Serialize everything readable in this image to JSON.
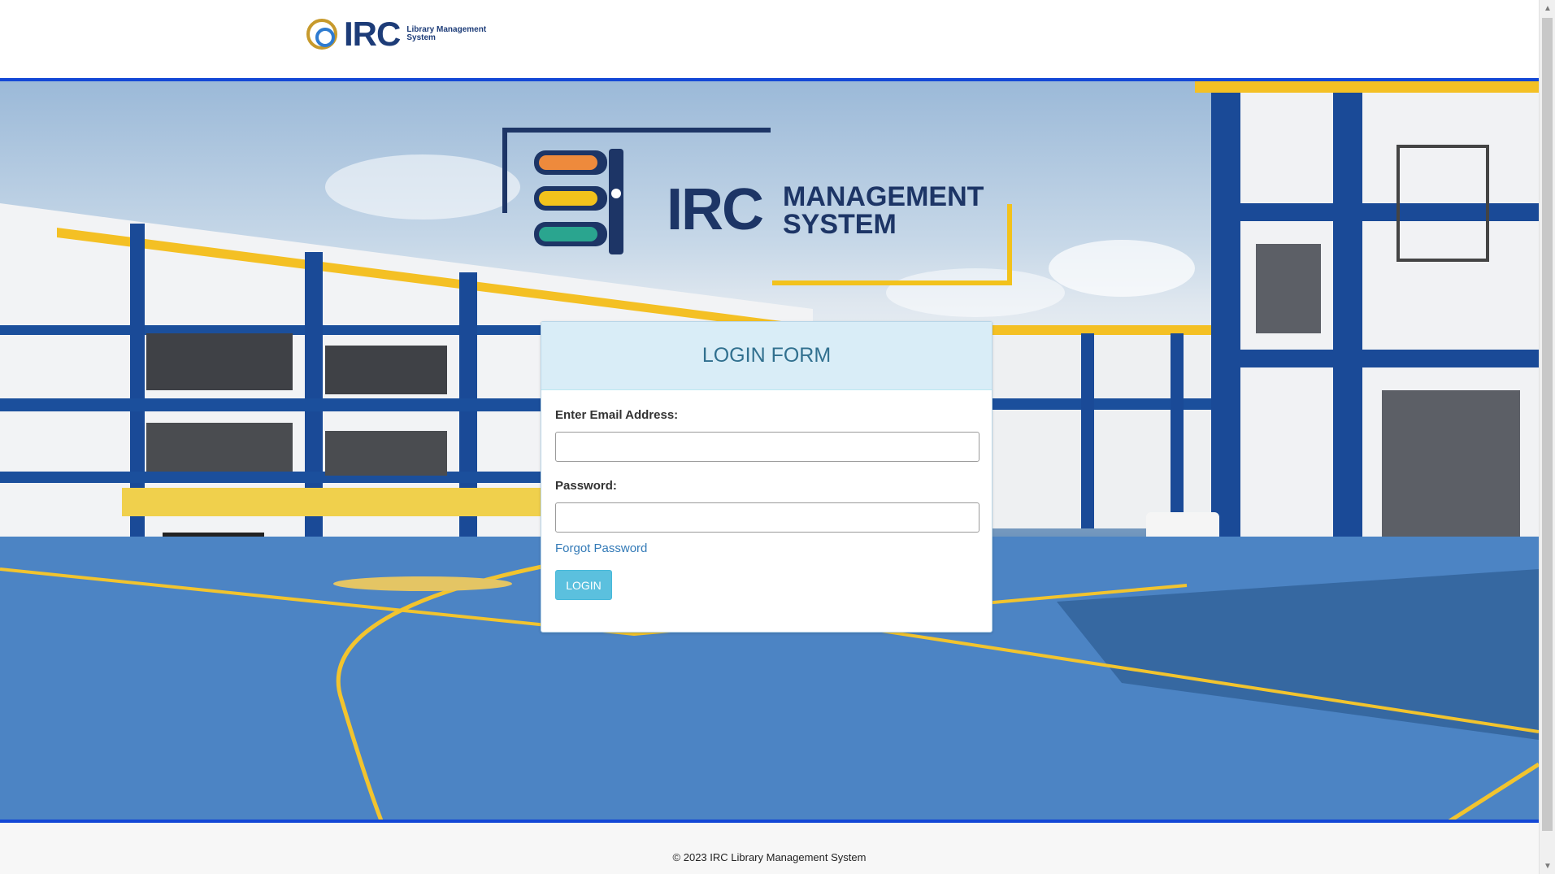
{
  "header": {
    "logo_text": "IRC",
    "logo_subtitle": "Library Management System"
  },
  "hero": {
    "logo_main": "IRC",
    "logo_line1": "MANAGEMENT",
    "logo_line2": "SYSTEM"
  },
  "login": {
    "title": "LOGIN FORM",
    "email_label": "Enter Email Address:",
    "email_value": "",
    "password_label": "Password:",
    "password_value": "",
    "forgot_link": "Forgot Password",
    "submit_label": "LOGIN"
  },
  "footer": {
    "copyright": "© 2023 IRC Library Management System"
  },
  "colors": {
    "accent_blue": "#1347d6",
    "login_button": "#5bc0de",
    "panel_heading": "#d9edf7",
    "logo_navy": "#1d3566",
    "logo_gold": "#f2c21c"
  },
  "icons": {
    "seal": "school-seal-icon",
    "books": "books-gear-icon",
    "scroll_up": "scroll-up-arrow-icon",
    "scroll_down": "scroll-down-arrow-icon"
  }
}
